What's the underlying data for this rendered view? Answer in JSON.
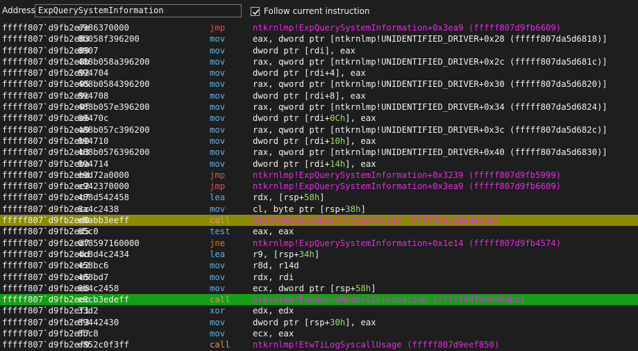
{
  "toolbar": {
    "address_label": "Address:",
    "address_value": "ExpQuerySystemInformation",
    "follow_label": "Follow current instruction",
    "follow_checked": true
  },
  "colors": {
    "background": "#1e1e1e",
    "mnemonic": "#5ab4e6",
    "jmp": "#e24b4b",
    "conditional_jump": "#e07a0a",
    "call": "#d79b5a",
    "symbol_target": "#e62ae6",
    "number": "#9cdc6a",
    "highlight_breakpoint": "#8c8c00",
    "highlight_current": "#14a014"
  },
  "rows": [
    {
      "addr": "fffff807`d9fb2e7e",
      "bytes": "e986370000",
      "mnem": "jmp",
      "kind": "jmp",
      "ops": [
        {
          "t": "ntkrnlmp!ExpQuerySystemInformation+0x3ea9 (fffff807d9fb6609)",
          "c": "target"
        }
      ]
    },
    {
      "addr": "fffff807`d9fb2e83",
      "bytes": "8b058f396200",
      "mnem": "mov",
      "kind": "mnem",
      "ops": [
        {
          "t": "eax, dword ptr [ntkrnlmp!UNIDENTIFIED_DRIVER+0x28 (fffff807da5d6818)]",
          "c": "white"
        }
      ]
    },
    {
      "addr": "fffff807`d9fb2e89",
      "bytes": "8907",
      "mnem": "mov",
      "kind": "mnem",
      "ops": [
        {
          "t": "dword ptr [rdi], eax",
          "c": "white"
        }
      ]
    },
    {
      "addr": "fffff807`d9fb2e8b",
      "bytes": "488b058a396200",
      "mnem": "mov",
      "kind": "mnem",
      "ops": [
        {
          "t": "rax, qword ptr [ntkrnlmp!UNIDENTIFIED_DRIVER+0x2c (fffff807da5d681c)]",
          "c": "white"
        }
      ]
    },
    {
      "addr": "fffff807`d9fb2e92",
      "bytes": "894704",
      "mnem": "mov",
      "kind": "mnem",
      "ops": [
        {
          "t": "dword ptr [rdi+4], eax",
          "c": "white"
        }
      ]
    },
    {
      "addr": "fffff807`d9fb2e95",
      "bytes": "488b0584396200",
      "mnem": "mov",
      "kind": "mnem",
      "ops": [
        {
          "t": "rax, qword ptr [ntkrnlmp!UNIDENTIFIED_DRIVER+0x30 (fffff807da5d6820)]",
          "c": "white"
        }
      ]
    },
    {
      "addr": "fffff807`d9fb2e9c",
      "bytes": "894708",
      "mnem": "mov",
      "kind": "mnem",
      "ops": [
        {
          "t": "dword ptr [rdi+8], eax",
          "c": "white"
        }
      ]
    },
    {
      "addr": "fffff807`d9fb2e9f",
      "bytes": "488b057e396200",
      "mnem": "mov",
      "kind": "mnem",
      "ops": [
        {
          "t": "rax, qword ptr [ntkrnlmp!UNIDENTIFIED_DRIVER+0x34 (fffff807da5d6824)]",
          "c": "white"
        }
      ]
    },
    {
      "addr": "fffff807`d9fb2ea6",
      "bytes": "89470c",
      "mnem": "mov",
      "kind": "mnem",
      "ops": [
        {
          "t": "dword ptr [rdi+",
          "c": "white"
        },
        {
          "t": "0Ch",
          "c": "num"
        },
        {
          "t": "], eax",
          "c": "white"
        }
      ]
    },
    {
      "addr": "fffff807`d9fb2ea9",
      "bytes": "488b057c396200",
      "mnem": "mov",
      "kind": "mnem",
      "ops": [
        {
          "t": "rax, qword ptr [ntkrnlmp!UNIDENTIFIED_DRIVER+0x3c (fffff807da5d682c)]",
          "c": "white"
        }
      ]
    },
    {
      "addr": "fffff807`d9fb2eb0",
      "bytes": "894710",
      "mnem": "mov",
      "kind": "mnem",
      "ops": [
        {
          "t": "dword ptr [rdi+",
          "c": "white"
        },
        {
          "t": "10h",
          "c": "num"
        },
        {
          "t": "], eax",
          "c": "white"
        }
      ]
    },
    {
      "addr": "fffff807`d9fb2eb3",
      "bytes": "488b0576396200",
      "mnem": "mov",
      "kind": "mnem",
      "ops": [
        {
          "t": "rax, qword ptr [ntkrnlmp!UNIDENTIFIED_DRIVER+0x40 (fffff807da5d6830)]",
          "c": "white"
        }
      ]
    },
    {
      "addr": "fffff807`d9fb2eba",
      "bytes": "894714",
      "mnem": "mov",
      "kind": "mnem",
      "ops": [
        {
          "t": "dword ptr [rdi+",
          "c": "white"
        },
        {
          "t": "14h",
          "c": "num"
        },
        {
          "t": "], eax",
          "c": "white"
        }
      ]
    },
    {
      "addr": "fffff807`d9fb2ebd",
      "bytes": "e9d72a0000",
      "mnem": "jmp",
      "kind": "jmp",
      "ops": [
        {
          "t": "ntkrnlmp!ExpQuerySystemInformation+0x3239 (fffff807d9fb5999)",
          "c": "target"
        }
      ]
    },
    {
      "addr": "fffff807`d9fb2ec2",
      "bytes": "e942370000",
      "mnem": "jmp",
      "kind": "jmp",
      "ops": [
        {
          "t": "ntkrnlmp!ExpQuerySystemInformation+0x3ea9 (fffff807d9fb6609)",
          "c": "target"
        }
      ]
    },
    {
      "addr": "fffff807`d9fb2ec7",
      "bytes": "488d542458",
      "mnem": "lea",
      "kind": "mnem",
      "ops": [
        {
          "t": "rdx, [rsp+",
          "c": "white"
        },
        {
          "t": "58h",
          "c": "num"
        },
        {
          "t": "]",
          "c": "white"
        }
      ]
    },
    {
      "addr": "fffff807`d9fb2ecc",
      "bytes": "8a4c2438",
      "mnem": "mov",
      "kind": "mnem",
      "ops": [
        {
          "t": "cl, byte ptr [rsp+",
          "c": "white"
        },
        {
          "t": "38h",
          "c": "num"
        },
        {
          "t": "]",
          "c": "white"
        }
      ]
    },
    {
      "addr": "fffff807`d9fb2ed0",
      "bytes": "e8abb3eeff",
      "mnem": "call",
      "kind": "call",
      "hl": "yellow",
      "ops": [
        {
          "t": "ntkrnlmp!ExIsRestrictedCaller (fffff807d9e9e280)",
          "c": "target"
        }
      ]
    },
    {
      "addr": "fffff807`d9fb2ed5",
      "bytes": "85c0",
      "mnem": "test",
      "kind": "mnem",
      "ops": [
        {
          "t": "eax, eax",
          "c": "white"
        }
      ]
    },
    {
      "addr": "fffff807`d9fb2ed7",
      "bytes": "0f8597160000",
      "mnem": "jne",
      "kind": "jcc",
      "ops": [
        {
          "t": "ntkrnlmp!ExpQuerySystemInformation+0x1e14 (fffff807d9fb4574)",
          "c": "target"
        }
      ]
    },
    {
      "addr": "fffff807`d9fb2edd",
      "bytes": "4c8d4c2434",
      "mnem": "lea",
      "kind": "mnem",
      "ops": [
        {
          "t": "r9, [rsp+",
          "c": "white"
        },
        {
          "t": "34h",
          "c": "num"
        },
        {
          "t": "]",
          "c": "white"
        }
      ]
    },
    {
      "addr": "fffff807`d9fb2ee2",
      "bytes": "458bc6",
      "mnem": "mov",
      "kind": "mnem",
      "ops": [
        {
          "t": "r8d, r14d",
          "c": "white"
        }
      ]
    },
    {
      "addr": "fffff807`d9fb2ee5",
      "bytes": "488bd7",
      "mnem": "mov",
      "kind": "mnem",
      "ops": [
        {
          "t": "rdx, rdi",
          "c": "white"
        }
      ]
    },
    {
      "addr": "fffff807`d9fb2ee8",
      "bytes": "8b4c2458",
      "mnem": "mov",
      "kind": "mnem",
      "ops": [
        {
          "t": "ecx, dword ptr [rsp+",
          "c": "white"
        },
        {
          "t": "58h",
          "c": "num"
        },
        {
          "t": "]",
          "c": "white"
        }
      ]
    },
    {
      "addr": "fffff807`d9fb2eec",
      "bytes": "e8cb3edeff",
      "mnem": "call",
      "kind": "call",
      "hl": "green",
      "ops": [
        {
          "t": "ntkrnlmp!ExpQueryModuleInformation (fffff807d9d96dbc)",
          "c": "target"
        }
      ]
    },
    {
      "addr": "fffff807`d9fb2ef1",
      "bytes": "33d2",
      "mnem": "xor",
      "kind": "mnem",
      "ops": [
        {
          "t": "edx, edx",
          "c": "white"
        }
      ]
    },
    {
      "addr": "fffff807`d9fb2ef3",
      "bytes": "89442430",
      "mnem": "mov",
      "kind": "mnem",
      "ops": [
        {
          "t": "dword ptr [rsp+",
          "c": "white"
        },
        {
          "t": "30h",
          "c": "num"
        },
        {
          "t": "], eax",
          "c": "white"
        }
      ]
    },
    {
      "addr": "fffff807`d9fb2ef7",
      "bytes": "8bc8",
      "mnem": "mov",
      "kind": "mnem",
      "ops": [
        {
          "t": "ecx, eax",
          "c": "white"
        }
      ]
    },
    {
      "addr": "fffff807`d9fb2ef9",
      "bytes": "e852c0f3ff",
      "mnem": "call",
      "kind": "call",
      "ops": [
        {
          "t": "ntkrnlmp!EtwTiLogSyscallUsage (fffff807d9eef850)",
          "c": "target"
        }
      ]
    }
  ]
}
